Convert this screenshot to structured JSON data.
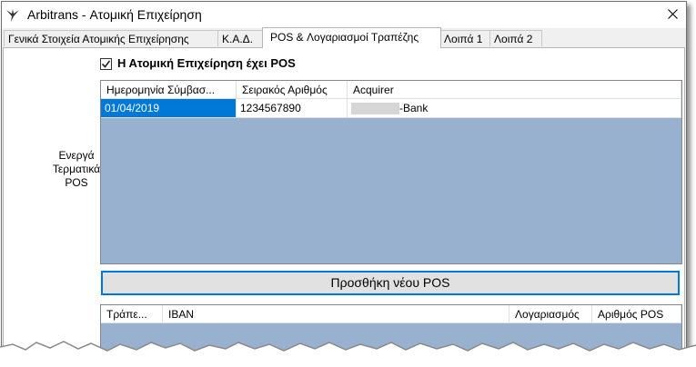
{
  "window": {
    "title": "Arbitrans - Ατομική Επιχείρηση",
    "icons": {
      "app": "arbitrans-logo-icon",
      "close": "close-icon"
    }
  },
  "tabs": [
    {
      "label": "Γενικά Στοιχεία Ατομικής Επιχείρησης",
      "active": false
    },
    {
      "label": "Κ.Α.Δ.",
      "active": false
    },
    {
      "label": "POS & Λογαριασμοί Τραπέζης",
      "active": true
    },
    {
      "label": "Λοιπά 1",
      "active": false
    },
    {
      "label": "Λοιπά 2",
      "active": false
    }
  ],
  "pos_section": {
    "checkbox_label": "Η Ατομική Επιχείρηση έχει POS",
    "checkbox_checked": true,
    "side_label_lines": [
      "Ενεργά",
      "Τερματικά",
      "POS"
    ]
  },
  "pos_grid": {
    "columns": [
      "Ημερομηνία Σύμβασ...",
      "Σειρακός Αριθμός",
      "Acquirer"
    ],
    "rows": [
      {
        "date": "01/04/2019",
        "serial": "1234567890",
        "acquirer": "-Bank",
        "selected": true
      }
    ]
  },
  "add_pos_button": "Προσθήκη νέου POS",
  "bank_grid": {
    "columns": [
      "Τράπε...",
      "IBAN",
      "Λογαριασμός",
      "Αριθμός POS"
    ]
  },
  "colors": {
    "grid_background": "#98b1cf",
    "selection": "#0078d7",
    "button_border": "#0078d7"
  }
}
